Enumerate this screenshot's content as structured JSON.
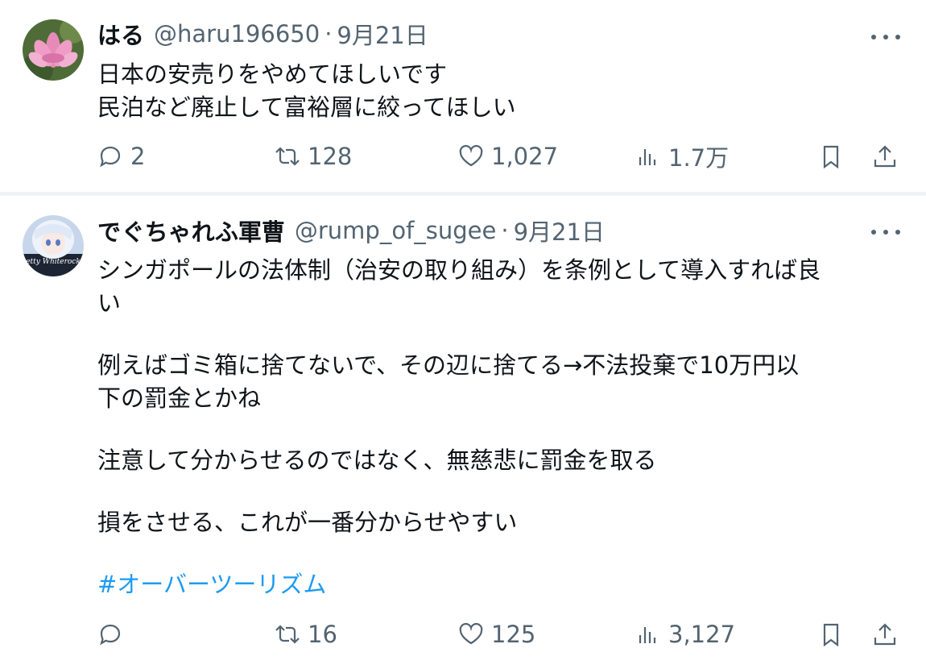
{
  "tweets": [
    {
      "display_name": "はる",
      "handle": "@haru196650",
      "separator": "·",
      "date": "9月21日",
      "lines": [
        "日本の安売りをやめてほしいです",
        "民泊など廃止して富裕層に絞ってほしい"
      ],
      "hashtag": "",
      "stats": {
        "replies": "2",
        "retweets": "128",
        "likes": "1,027",
        "views": "1.7万"
      }
    },
    {
      "display_name": "でぐちゃれふ軍曹",
      "handle": "@rump_of_sugee",
      "separator": "·",
      "date": "9月21日",
      "avatar_text": "etty Whiterock",
      "lines": [
        "シンガポールの法体制（治安の取り組み）を条例として導入すれば良",
        "い",
        "",
        "例えばゴミ箱に捨てないで、その辺に捨てる→不法投棄で10万円以",
        "下の罰金とかね",
        "",
        "注意して分からせるのではなく、無慈悲に罰金を取る",
        "",
        "損をさせる、これが一番分からせやすい",
        ""
      ],
      "hashtag": "#オーバーツーリズム",
      "stats": {
        "replies": "",
        "retweets": "16",
        "likes": "125",
        "views": "3,127"
      }
    }
  ],
  "icons": [
    "reply-icon",
    "retweet-icon",
    "like-icon",
    "views-icon",
    "bookmark-icon",
    "share-icon",
    "more-icon"
  ],
  "colors": {
    "text": "#0f1419",
    "secondary": "#536471",
    "link": "#1d9bf0",
    "divider": "#eff3f4"
  }
}
